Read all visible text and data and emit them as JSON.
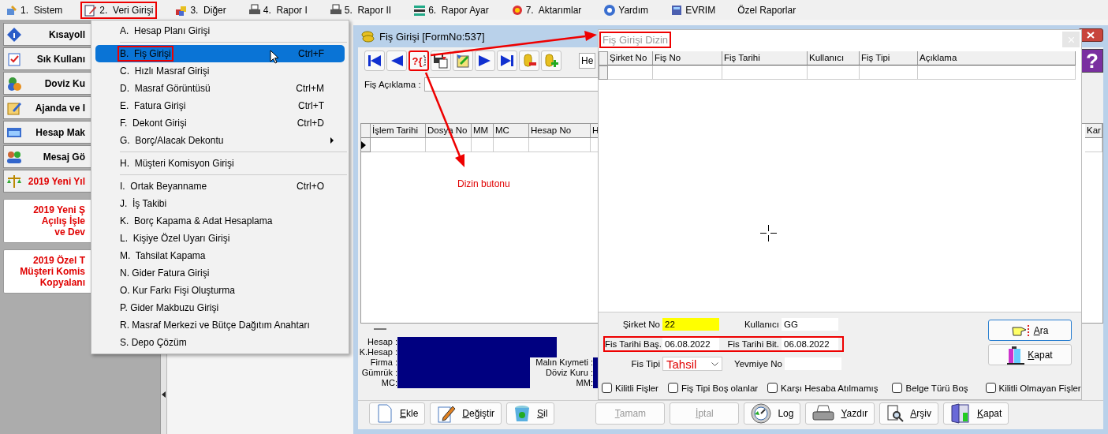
{
  "menubar": {
    "items": [
      {
        "label": "1.  Sistem",
        "boxed": false
      },
      {
        "label": "2.  Veri Girişi",
        "boxed": true
      },
      {
        "label": "3.  Diğer",
        "boxed": false
      },
      {
        "label": "4.  Rapor I",
        "boxed": false
      },
      {
        "label": "5.  Rapor II",
        "boxed": false
      },
      {
        "label": "6.  Rapor Ayar",
        "boxed": false
      },
      {
        "label": "7.  Aktarımlar",
        "boxed": false
      },
      {
        "label": "Yardım",
        "boxed": false
      },
      {
        "label": "EVRIM",
        "boxed": false
      },
      {
        "label": "Özel Raporlar",
        "boxed": false
      }
    ]
  },
  "sidebar": {
    "items": [
      {
        "kind": "tool",
        "label": "Kısayoll"
      },
      {
        "kind": "tool",
        "label": "Sık Kullanı"
      },
      {
        "kind": "tool",
        "label": "Doviz Ku"
      },
      {
        "kind": "tool",
        "label": "Ajanda ve I"
      },
      {
        "kind": "tool",
        "label": "Hesap Mak"
      },
      {
        "kind": "tool",
        "label": "Mesaj Gö"
      },
      {
        "kind": "alert",
        "label": "2019 Yeni Yıl"
      },
      {
        "kind": "card",
        "lines": [
          "2019 Yeni Ş",
          "Açılış İşle",
          "ve Dev"
        ]
      },
      {
        "kind": "card",
        "lines": [
          "2019 Özel T",
          "Müşteri Komis",
          "Kopyalanı"
        ]
      }
    ]
  },
  "dropdown_menu": {
    "sections": [
      [
        {
          "label": "A.  Hesap Planı Girişi",
          "selected": false,
          "boxed": false,
          "has_submenu": false
        }
      ],
      [
        {
          "label": "B.  Fiş Girişi",
          "shortcut": "Ctrl+F",
          "selected": true,
          "boxed": true,
          "has_submenu": false
        },
        {
          "label": "C.  Hızlı Masraf Girişi",
          "selected": false,
          "boxed": false,
          "has_submenu": false
        },
        {
          "label": "D.  Masraf Görüntüsü",
          "shortcut": "Ctrl+M",
          "selected": false,
          "boxed": false,
          "has_submenu": false
        },
        {
          "label": "E.  Fatura Girişi",
          "shortcut": "Ctrl+T",
          "selected": false,
          "boxed": false,
          "has_submenu": false
        },
        {
          "label": "F.  Dekont Girişi",
          "shortcut": "Ctrl+D",
          "selected": false,
          "boxed": false,
          "has_submenu": false
        },
        {
          "label": "G.  Borç/Alacak Dekontu",
          "selected": false,
          "boxed": false,
          "has_submenu": true
        }
      ],
      [
        {
          "label": "H.  Müşteri Komisyon Girişi",
          "selected": false,
          "boxed": false,
          "has_submenu": false
        }
      ],
      [
        {
          "label": "I.  Ortak Beyanname",
          "shortcut": "Ctrl+O",
          "selected": false,
          "boxed": false,
          "has_submenu": false
        },
        {
          "label": "J.  İş Takibi",
          "selected": false,
          "boxed": false,
          "has_submenu": false
        },
        {
          "label": "K.  Borç Kapama & Adat Hesaplama",
          "selected": false,
          "boxed": false,
          "has_submenu": false
        },
        {
          "label": "L.  Kişiye Özel Uyarı Girişi",
          "selected": false,
          "boxed": false,
          "has_submenu": false
        },
        {
          "label": "M.  Tahsilat Kapama",
          "selected": false,
          "boxed": false,
          "has_submenu": false
        },
        {
          "label": "N. Gider Fatura Girişi",
          "selected": false,
          "boxed": false,
          "has_submenu": false
        },
        {
          "label": "O. Kur Farkı Fişi Oluşturma",
          "selected": false,
          "boxed": false,
          "has_submenu": false
        },
        {
          "label": "P. Gider Makbuzu Girişi",
          "selected": false,
          "boxed": false,
          "has_submenu": false
        },
        {
          "label": "R. Masraf Merkezi ve Bütçe Dağıtım Anahtarı",
          "selected": false,
          "boxed": false,
          "has_submenu": false
        },
        {
          "label": "S. Depo Çözüm",
          "selected": false,
          "boxed": false,
          "has_submenu": false
        }
      ]
    ]
  },
  "main_window": {
    "title": "Fiş Girişi [FormNo:537]",
    "toolbar": {
      "buttons": [
        {
          "kind": "first",
          "boxed": false
        },
        {
          "kind": "prev",
          "boxed": false
        },
        {
          "kind": "index",
          "label": "?{",
          "boxed": true
        },
        {
          "kind": "save",
          "boxed": false
        },
        {
          "kind": "edit",
          "boxed": false
        },
        {
          "kind": "next",
          "boxed": false
        },
        {
          "kind": "last",
          "boxed": false
        },
        {
          "kind": "remove",
          "boxed": false
        },
        {
          "kind": "add",
          "boxed": false
        }
      ],
      "combo_value": "He",
      "help_label": "?"
    },
    "description_label": "Fiş Açıklama :",
    "grid": {
      "columns": [
        "İşlem Tarihi",
        "Dosya No",
        "MM",
        "MC",
        "Hesap No",
        "H"
      ],
      "right_columns": [
        "Kar"
      ]
    },
    "info": {
      "left_labels": [
        "Hesap :",
        "K.Hesap :",
        "Firma :",
        "Gümrük :",
        "MC:"
      ],
      "right_labels": [
        "Malın Kıymeti :",
        "Döviz Kuru :",
        "MM:"
      ]
    },
    "buttons": [
      {
        "kind": "add",
        "label": "Ekle",
        "disabled": false,
        "mnemonic": true
      },
      {
        "kind": "edit",
        "label": "Değiştir",
        "disabled": false,
        "mnemonic": true
      },
      {
        "kind": "delete",
        "label": "Sil",
        "disabled": false,
        "mnemonic": true
      },
      {
        "kind": "ok",
        "label": "Tamam",
        "disabled": true,
        "mnemonic": true
      },
      {
        "kind": "cancel",
        "label": "İptal",
        "disabled": true,
        "mnemonic": true
      },
      {
        "kind": "log",
        "label": "Log",
        "disabled": false,
        "mnemonic": false
      },
      {
        "kind": "print",
        "label": "Yazdır",
        "disabled": false,
        "mnemonic": true
      },
      {
        "kind": "archive",
        "label": "Arşiv",
        "disabled": false,
        "mnemonic": true
      },
      {
        "kind": "close",
        "label": "Kapat",
        "disabled": false,
        "mnemonic": true
      }
    ]
  },
  "dialog": {
    "title": "Fiş Girişi Dizin",
    "title_boxed": true,
    "columns": [
      "Şirket No",
      "Fiş No",
      "Fiş Tarihi",
      "Kullanıcı",
      "Fiş Tipi",
      "Açıklama"
    ],
    "filters": {
      "rows": [
        {
          "boxed": false,
          "fields": [
            {
              "kind": "text",
              "label": "Şirket No",
              "value": "22",
              "highlighted": true
            },
            {
              "kind": "text",
              "label": "Kullanıcı",
              "value": "GG",
              "highlighted": false
            }
          ]
        },
        {
          "boxed": true,
          "fields": [
            {
              "kind": "text",
              "label": "Fis Tarihi Baş.",
              "value": "06.08.2022",
              "highlighted": false
            },
            {
              "kind": "text",
              "label": "Fis Tarihi Bit.",
              "value": "06.08.2022",
              "highlighted": false
            }
          ]
        },
        {
          "boxed": false,
          "fields": [
            {
              "kind": "dropdown",
              "label": "Fis Tipi",
              "value": "Tahsil",
              "highlighted": false
            },
            {
              "kind": "text",
              "label": "Yevmiye No",
              "highlighted": false
            }
          ]
        }
      ]
    },
    "checkboxes": [
      {
        "label": "Kilitli Fişler",
        "checked": false
      },
      {
        "label": "Fiş Tipi Boş olanlar",
        "checked": false
      },
      {
        "label": "Karşı Hesaba Atılmamış",
        "checked": false
      },
      {
        "label": "Belge Türü Boş",
        "checked": false
      },
      {
        "label": "Kilitli Olmayan Fişler",
        "checked": false
      }
    ],
    "buttons": [
      {
        "kind": "search",
        "label": "Ara",
        "focused": true
      },
      {
        "kind": "close",
        "label": "Kapat",
        "focused": false
      }
    ]
  },
  "annotation": {
    "label": "Dizin butonu"
  }
}
